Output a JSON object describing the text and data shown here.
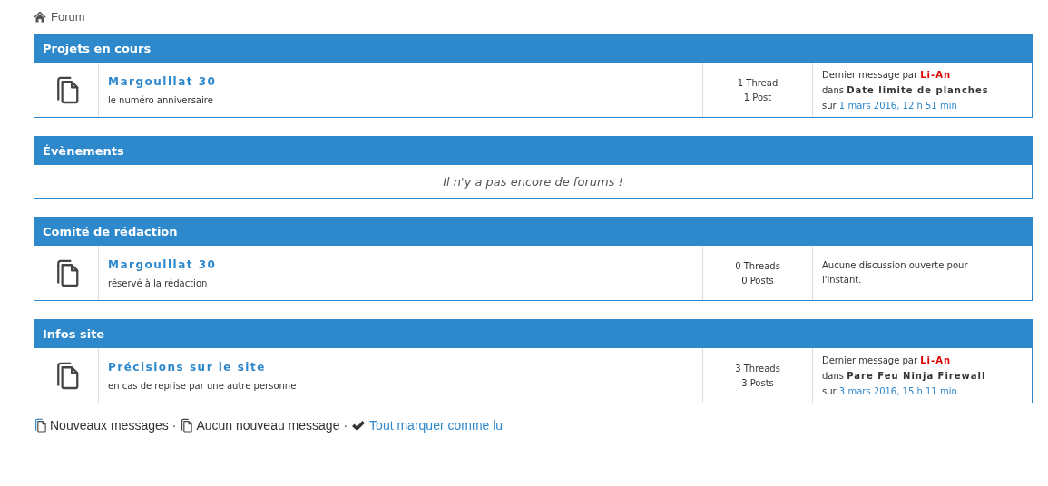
{
  "breadcrumb": {
    "label": "Forum"
  },
  "sections": [
    {
      "title": "Projets en cours",
      "forums": [
        {
          "name": "Margoulllat 30",
          "description": "le numéro anniversaire",
          "threads": "1 Thread",
          "posts": "1 Post",
          "last_post": {
            "kind": "post",
            "prefix": "Dernier message par",
            "author": "Li-An",
            "in": "dans",
            "topic": "Date limite de planches",
            "on": "sur",
            "date": "1 mars 2016, 12 h 51 min"
          }
        }
      ]
    },
    {
      "title": "Évènements",
      "empty_text": "Il n'y a pas encore de forums !"
    },
    {
      "title": "Comité de rédaction",
      "forums": [
        {
          "name": "Margoulllat 30",
          "description": "réservé à la rédaction",
          "threads": "0 Threads",
          "posts": "0 Posts",
          "last_post": {
            "kind": "none",
            "text": "Aucune discussion ouverte pour l'instant."
          }
        }
      ]
    },
    {
      "title": "Infos site",
      "forums": [
        {
          "name": "Précisions sur le site",
          "description": "en cas de reprise par une autre personne",
          "threads": "3 Threads",
          "posts": "3 Posts",
          "last_post": {
            "kind": "post",
            "prefix": "Dernier message par",
            "author": "Li-An",
            "in": "dans",
            "topic": "Pare Feu Ninja Firewall",
            "on": "sur",
            "date": "3 mars 2016, 15 h 11 min"
          }
        }
      ]
    }
  ],
  "legend": [
    {
      "kind": "new",
      "label": "Nouveaux messages"
    },
    {
      "kind": "separator",
      "label": "·"
    },
    {
      "kind": "none",
      "label": "Aucun nouveau message"
    },
    {
      "kind": "separator",
      "label": "·"
    },
    {
      "kind": "mark",
      "label": "Tout marquer comme lu"
    }
  ]
}
